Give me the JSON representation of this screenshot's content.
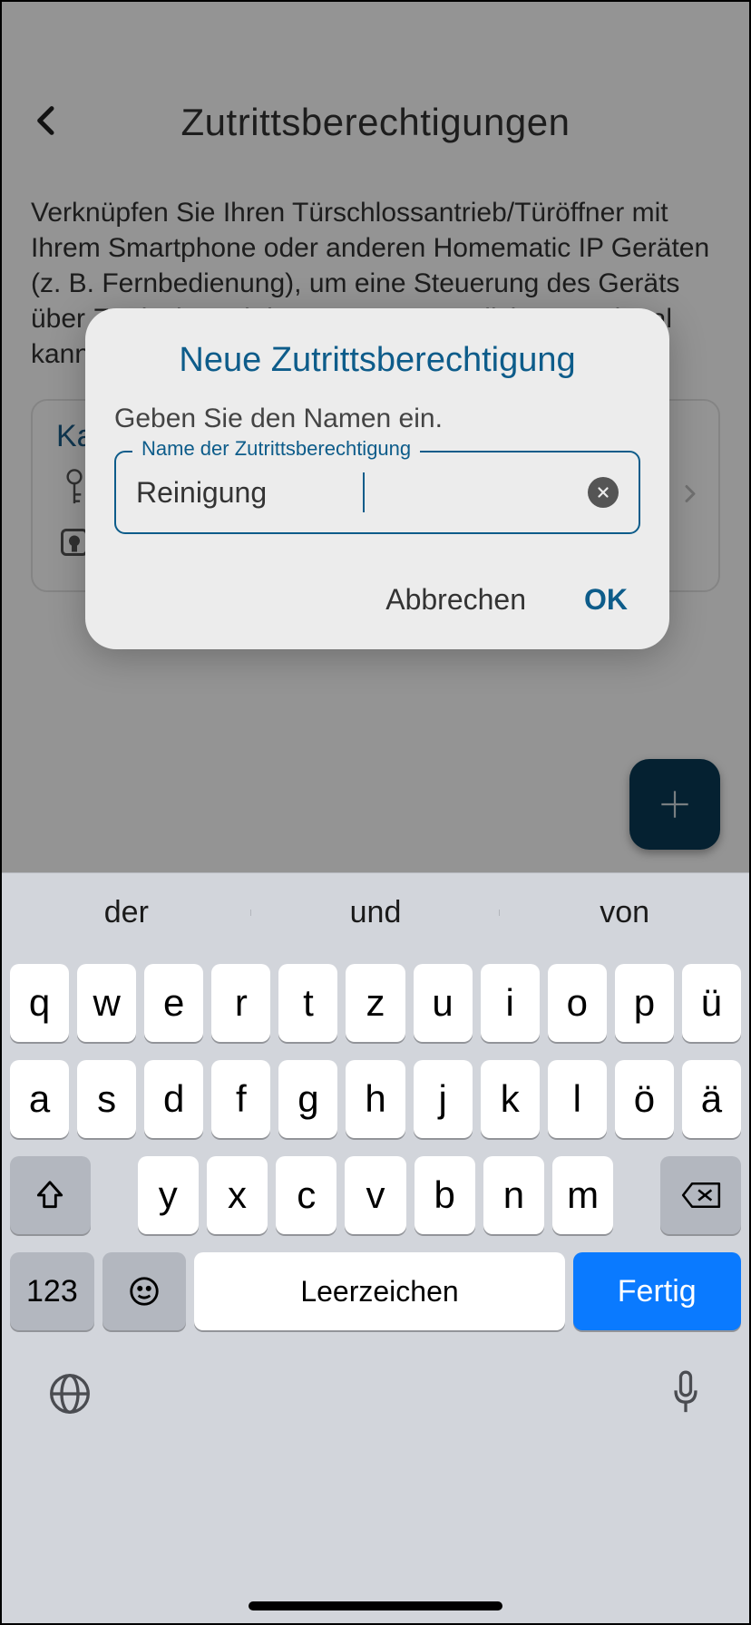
{
  "header": {
    "title": "Zutrittsberechtigungen"
  },
  "description": "Verknüpfen Sie Ihren Türschlossantrieb/Türöffner mit Ihrem Smartphone oder anderen Homematic IP Geräten (z. B. Fernbedienung), um eine Steuerung des Geräts über Zutrittsberechtigungen zu ermöglichen. Optional kann das System durch eine PIN gesichert werden.",
  "card": {
    "title": "Karl-Heinz"
  },
  "dialog": {
    "title": "Neue Zutrittsberechtigung",
    "subtitle": "Geben Sie den Namen ein.",
    "field_label": "Name der Zutrittsberechtigung",
    "field_value": "Reinigung",
    "cancel": "Abbrechen",
    "ok": "OK"
  },
  "keyboard": {
    "suggestions": [
      "der",
      "und",
      "von"
    ],
    "row1": [
      "q",
      "w",
      "e",
      "r",
      "t",
      "z",
      "u",
      "i",
      "o",
      "p",
      "ü"
    ],
    "row2": [
      "a",
      "s",
      "d",
      "f",
      "g",
      "h",
      "j",
      "k",
      "l",
      "ö",
      "ä"
    ],
    "row3": [
      "y",
      "x",
      "c",
      "v",
      "b",
      "n",
      "m"
    ],
    "numbers": "123",
    "space": "Leerzeichen",
    "done": "Fertig"
  }
}
